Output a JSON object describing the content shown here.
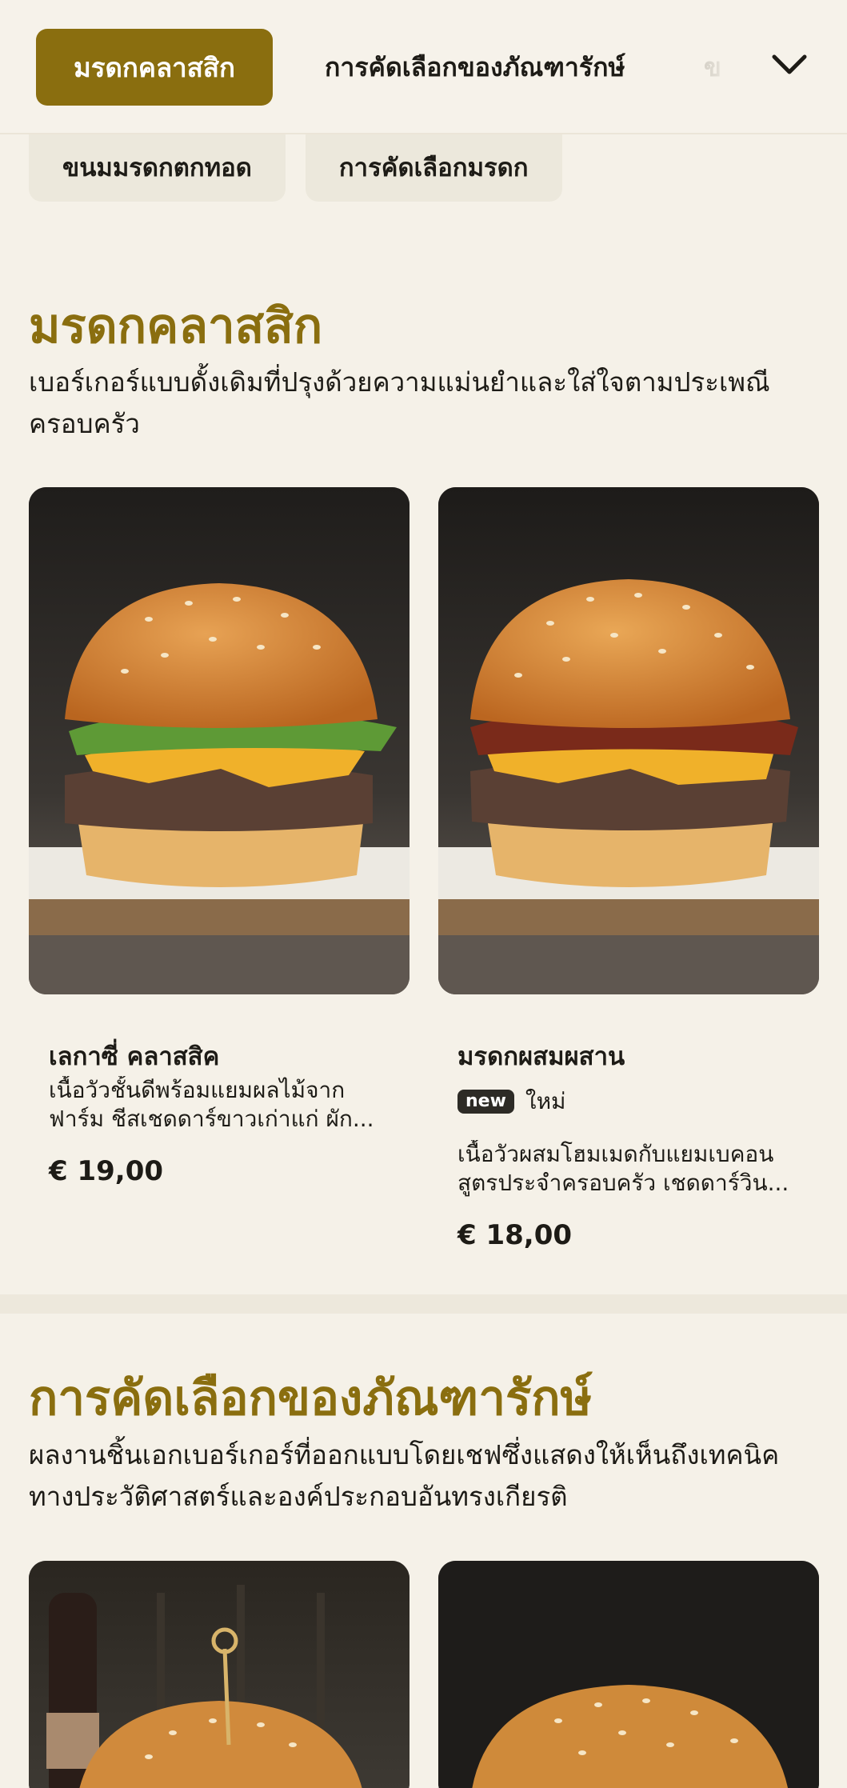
{
  "nav": {
    "active_tab": "มรดกคลาสสิก",
    "tab_2": "การคัดเลือกของภัณฑารักษ์",
    "tab_3_partial": "ข",
    "row2": [
      "ขนมมรดกตกทอด",
      "การคัดเลือกมรดก"
    ]
  },
  "sections": [
    {
      "title": "มรดกคลาสสิก",
      "description": "เบอร์เกอร์แบบดั้งเดิมที่ปรุงด้วยความแม่นยำและใส่ใจตามประเพณีครอบครัว",
      "items": [
        {
          "name": "เลกาซี่ คลาสสิค",
          "description": "เนื้อวัวชั้นดีพร้อมแยมผลไม้จากฟาร์ม ชีสเชดดาร์ขาวเก่าแก่ ผัก...",
          "price": "€ 19,00"
        },
        {
          "name": "มรดกผสมผสาน",
          "badge": "new",
          "badge_label": "ใหม่",
          "description": "เนื้อวัวผสมโฮมเมดกับแยมเบคอนสูตรประจำครอบครัว เชดดาร์วิน...",
          "price": "€ 18,00"
        }
      ]
    },
    {
      "title": "การคัดเลือกของภัณฑารักษ์",
      "description": "ผลงานชิ้นเอกเบอร์เกอร์ที่ออกแบบโดยเชฟซึ่งแสดงให้เห็นถึงเทคนิคทางประวัติศาสตร์และองค์ประกอบอันทรงเกียรติ"
    }
  ],
  "colors": {
    "accent": "#8a6e0f",
    "background": "#f5f1e8",
    "chip": "#ece8dc",
    "badge": "#2d2b26"
  },
  "icons": {
    "menu_expand": "chevron-down-icon"
  }
}
